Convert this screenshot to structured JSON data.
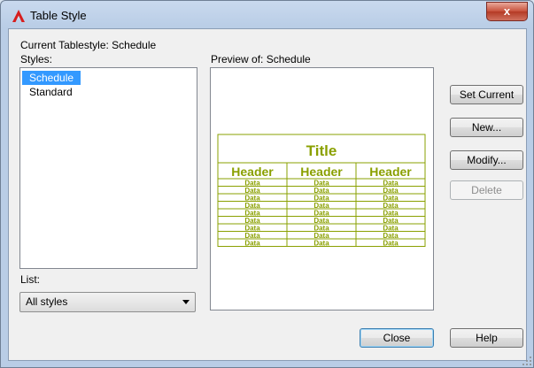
{
  "window": {
    "title": "Table Style",
    "close_glyph": "x",
    "current_tablestyle_label": "Current Tablestyle: Schedule",
    "styles_label": "Styles:",
    "styles": [
      {
        "label": "Schedule",
        "selected": true
      },
      {
        "label": "Standard",
        "selected": false
      }
    ],
    "list_label": "List:",
    "list_value": "All styles",
    "preview_label": "Preview of: Schedule",
    "preview": {
      "title": "Title",
      "headers": [
        "Header",
        "Header",
        "Header"
      ],
      "data_text": "Data",
      "data_rows": 9,
      "color": "#8aa000"
    },
    "buttons": {
      "set_current": "Set Current",
      "new": "New...",
      "modify": "Modify...",
      "delete": "Delete",
      "close": "Close",
      "help": "Help"
    }
  },
  "colors": {
    "selection": "#3399ff",
    "close_button": "#c7503a",
    "frame": "#b9cde6",
    "app_icon": "#d71e1e"
  },
  "icons": {
    "app": "autocad-a-icon",
    "close": "close-icon",
    "dropdown": "chevron-down-icon",
    "grip": "resize-grip-icon"
  }
}
